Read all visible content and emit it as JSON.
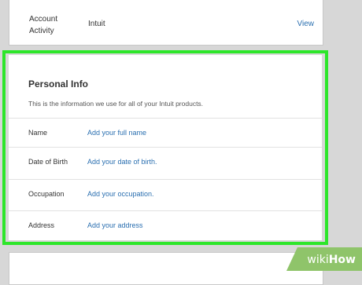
{
  "account_activity": {
    "label": "Account Activity",
    "value": "Intuit",
    "link": "View"
  },
  "personal_info": {
    "title": "Personal Info",
    "description": "This is the information we use for all of your Intuit products.",
    "rows": [
      {
        "label": "Name",
        "link": "Add your full name"
      },
      {
        "label": "Date of Birth",
        "link": "Add your date of birth."
      },
      {
        "label": "Occupation",
        "link": "Add your occupation."
      },
      {
        "label": "Address",
        "link": "Add your address"
      }
    ]
  },
  "watermark": {
    "prefix": "wiki",
    "suffix": "How"
  },
  "colors": {
    "highlight": "#2de62a",
    "link": "#2a6fb0",
    "watermark_bg": "#8fc46a"
  }
}
